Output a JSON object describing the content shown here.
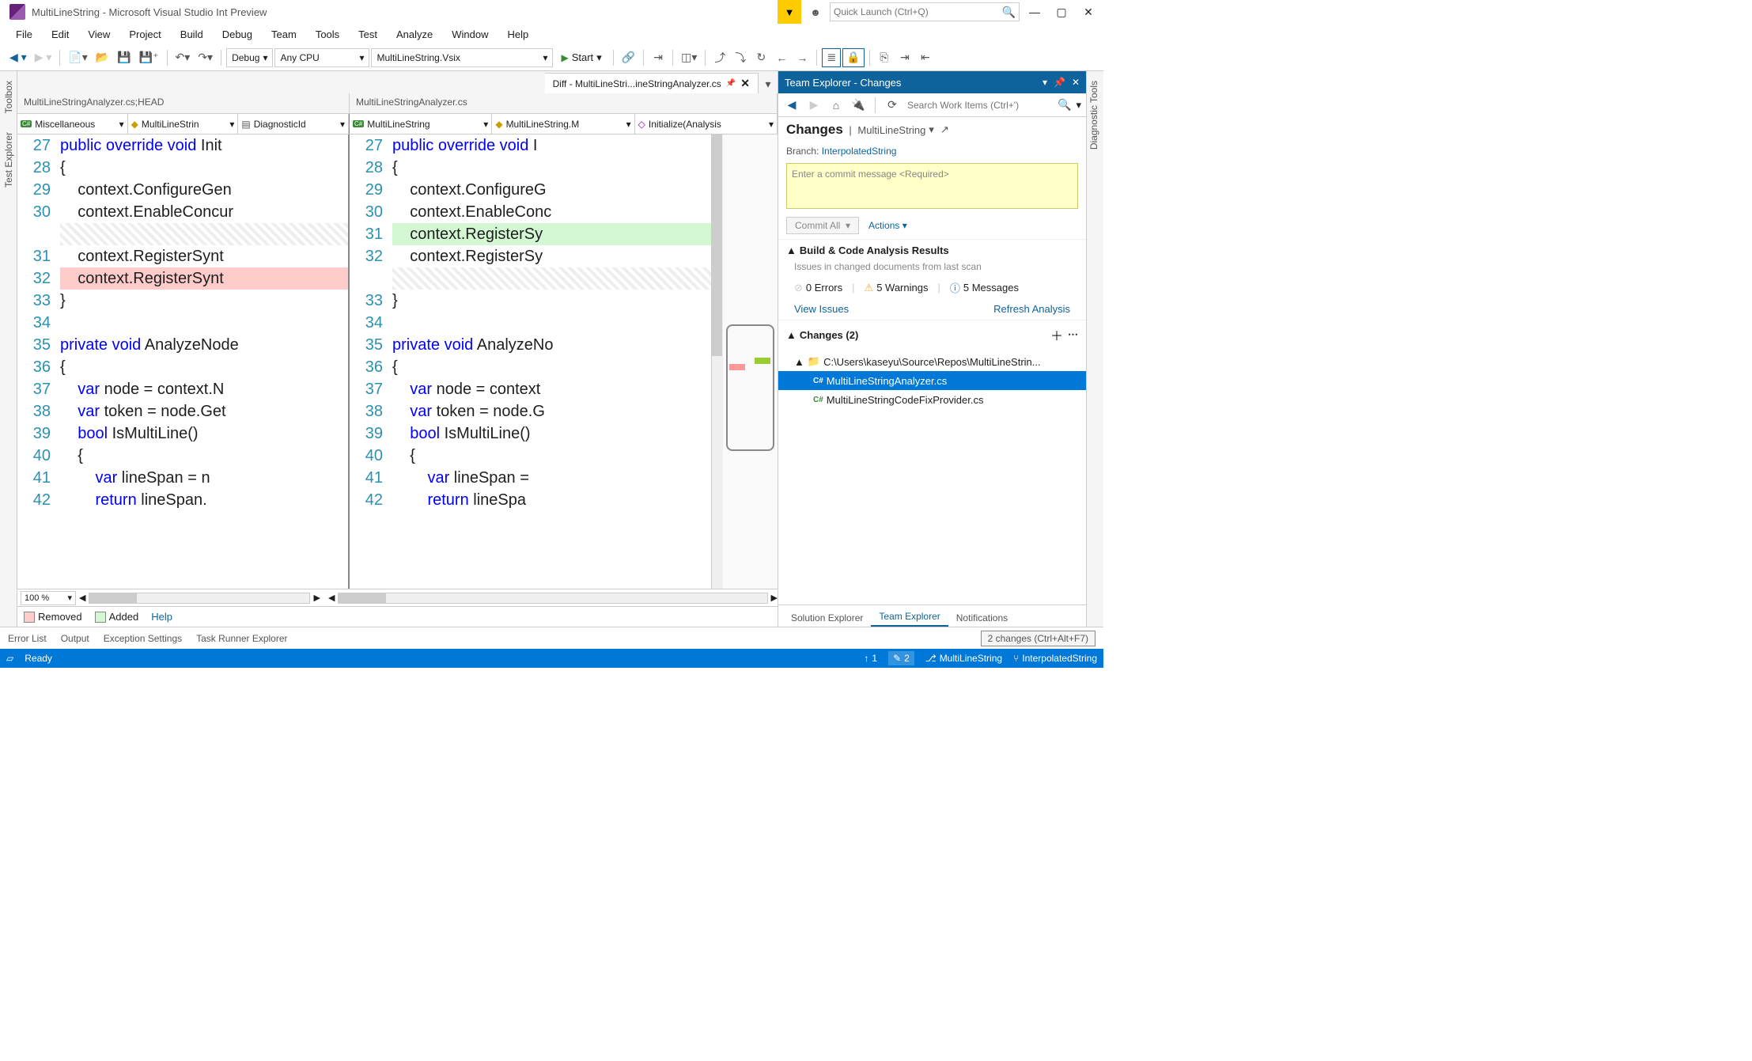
{
  "title": "MultiLineString - Microsoft Visual Studio Int Preview",
  "quickLaunch": {
    "placeholder": "Quick Launch (Ctrl+Q)"
  },
  "menu": [
    "File",
    "Edit",
    "View",
    "Project",
    "Build",
    "Debug",
    "Team",
    "Tools",
    "Test",
    "Analyze",
    "Window",
    "Help"
  ],
  "toolbar": {
    "config": "Debug",
    "platform": "Any CPU",
    "startupProject": "MultiLineString.Vsix",
    "start": "Start"
  },
  "leftTools": [
    "Toolbox",
    "Test Explorer"
  ],
  "rightTools": [
    "Diagnostic Tools"
  ],
  "documentTab": "Diff - MultiLineStri...ineStringAnalyzer.cs",
  "paneHeaders": {
    "left": "MultiLineStringAnalyzer.cs;HEAD",
    "right": "MultiLineStringAnalyzer.cs"
  },
  "navLeft": {
    "a": "Miscellaneous",
    "b": "MultiLineStrin",
    "c": "DiagnosticId"
  },
  "navRight": {
    "a": "MultiLineString",
    "b": "MultiLineString.M",
    "c": "Initialize(Analysis"
  },
  "code": {
    "left": {
      "nums": [
        "27",
        "28",
        "29",
        "30",
        "",
        "31",
        "32",
        "33",
        "34",
        "35",
        "36",
        "37",
        "38",
        "39",
        "40",
        "41",
        "42"
      ],
      "lines": [
        {
          "t": "public override void Init",
          "kw": [
            "public",
            "override",
            "void"
          ]
        },
        {
          "t": "{"
        },
        {
          "t": "    context.ConfigureGen"
        },
        {
          "t": "    context.EnableConcur"
        },
        {
          "t": "",
          "cls": "hatched"
        },
        {
          "t": "    context.RegisterSynt"
        },
        {
          "t": "    context.RegisterSynt",
          "cls": "removed"
        },
        {
          "t": "}"
        },
        {
          "t": ""
        },
        {
          "t": "private void AnalyzeNode",
          "kw": [
            "private",
            "void"
          ]
        },
        {
          "t": "{"
        },
        {
          "t": "    var node = context.N",
          "kw": [
            "var"
          ]
        },
        {
          "t": "    var token = node.Get",
          "kw": [
            "var"
          ]
        },
        {
          "t": "    bool IsMultiLine()",
          "kw": [
            "bool"
          ]
        },
        {
          "t": "    {"
        },
        {
          "t": "        var lineSpan = n",
          "kw": [
            "var"
          ]
        },
        {
          "t": "        return lineSpan.",
          "kw": [
            "return"
          ]
        }
      ]
    },
    "right": {
      "nums": [
        "27",
        "28",
        "29",
        "30",
        "31",
        "32",
        "",
        "33",
        "34",
        "35",
        "36",
        "37",
        "38",
        "39",
        "40",
        "41",
        "42"
      ],
      "lines": [
        {
          "t": "public override void I",
          "kw": [
            "public",
            "override",
            "void"
          ]
        },
        {
          "t": "{"
        },
        {
          "t": "    context.ConfigureG"
        },
        {
          "t": "    context.EnableConc"
        },
        {
          "t": "    context.RegisterSy",
          "cls": "added",
          "bar": true
        },
        {
          "t": "    context.RegisterSy",
          "bar": true
        },
        {
          "t": "",
          "cls": "hatched",
          "bar": true
        },
        {
          "t": "}",
          "bar": true
        },
        {
          "t": ""
        },
        {
          "t": "private void AnalyzeNo",
          "kw": [
            "private",
            "void"
          ]
        },
        {
          "t": "{"
        },
        {
          "t": "    var node = context",
          "kw": [
            "var"
          ]
        },
        {
          "t": "    var token = node.G",
          "kw": [
            "var"
          ]
        },
        {
          "t": "    bool IsMultiLine()",
          "kw": [
            "bool"
          ]
        },
        {
          "t": "    {"
        },
        {
          "t": "        var lineSpan =",
          "kw": [
            "var"
          ]
        },
        {
          "t": "        return lineSpa",
          "kw": [
            "return"
          ]
        }
      ]
    }
  },
  "zoom": "100 %",
  "legend": {
    "removed": "Removed",
    "added": "Added",
    "help": "Help"
  },
  "bottomTabs": [
    "Error List",
    "Output",
    "Exception Settings",
    "Task Runner Explorer"
  ],
  "changesTooltip": "2 changes (Ctrl+Alt+F7)",
  "panel": {
    "title": "Team Explorer - Changes",
    "searchPlaceholder": "Search Work Items (Ctrl+')",
    "heading": "Changes",
    "repo": "MultiLineString",
    "branchLabel": "Branch:",
    "branch": "InterpolatedString",
    "commitPlaceholder": "Enter a commit message <Required>",
    "commitButton": "Commit All",
    "actions": "Actions",
    "buildHeading": "Build & Code Analysis Results",
    "buildSub": "Issues in changed documents from last scan",
    "errors": "0 Errors",
    "warnings": "5 Warnings",
    "messages": "5 Messages",
    "viewIssues": "View Issues",
    "refresh": "Refresh Analysis",
    "changesHeading": "Changes (2)",
    "folder": "C:\\Users\\kaseyu\\Source\\Repos\\MultiLineStrin...",
    "files": [
      "MultiLineStringAnalyzer.cs",
      "MultiLineStringCodeFixProvider.cs"
    ],
    "tabs": [
      "Solution Explorer",
      "Team Explorer",
      "Notifications"
    ]
  },
  "status": {
    "ready": "Ready",
    "up": "1",
    "pencil": "2",
    "project": "MultiLineString",
    "branch": "InterpolatedString"
  }
}
